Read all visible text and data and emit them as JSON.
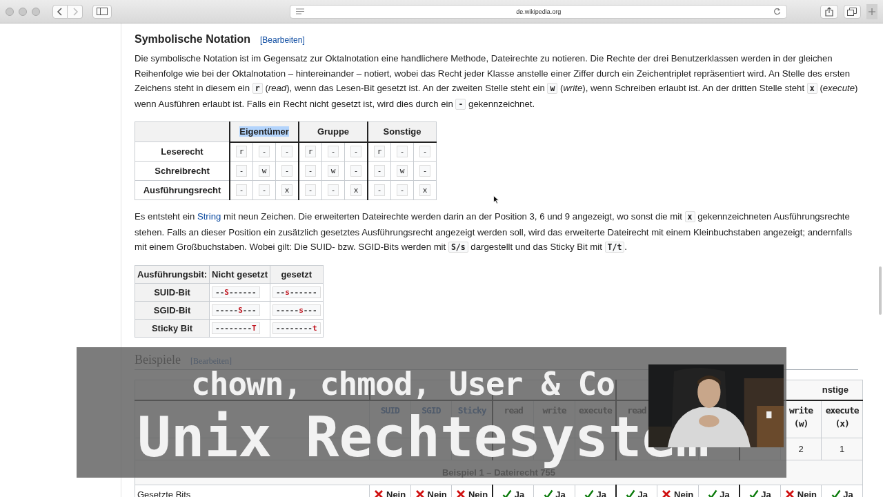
{
  "browser": {
    "url": "de.wikipedia.org"
  },
  "section": {
    "title": "Symbolische Notation",
    "edit": "[Bearbeiten]"
  },
  "paragraph_1": [
    {
      "text": "Die symbolische Notation ist im Gegensatz zur Oktalnotation eine handlichere Methode, Dateirechte zu notieren. Die Rechte der drei Benutzerklassen werden in der gleichen Reihenfolge wie bei der Oktalnotation – hintereinander – notiert, wobei das Recht jeder Klasse anstelle einer Ziffer durch ein Zeichentriplet repräsentiert wird. An Stelle des ersten Zeichens steht in diesem ein ",
      "kind": "plain"
    },
    {
      "text": "r",
      "kind": "code"
    },
    {
      "text": " (",
      "kind": "plain"
    },
    {
      "text": "read",
      "kind": "italic"
    },
    {
      "text": "), wenn das Lesen-Bit gesetzt ist. An der zweiten Stelle steht ein ",
      "kind": "plain"
    },
    {
      "text": "w",
      "kind": "code"
    },
    {
      "text": " (",
      "kind": "plain"
    },
    {
      "text": "write",
      "kind": "italic"
    },
    {
      "text": "), wenn Schreiben erlaubt ist. An der dritten Stelle steht ",
      "kind": "plain"
    },
    {
      "text": "x",
      "kind": "code"
    },
    {
      "text": " (",
      "kind": "plain"
    },
    {
      "text": "execute",
      "kind": "italic"
    },
    {
      "text": ") wenn Ausführen erlaubt ist. Falls ein Recht nicht gesetzt ist, wird dies durch ein ",
      "kind": "plain"
    },
    {
      "text": "-",
      "kind": "code"
    },
    {
      "text": " gekennzeichnet.",
      "kind": "plain"
    }
  ],
  "rights_table": {
    "groups": [
      {
        "label": "Eigentümer",
        "highlighted": true
      },
      {
        "label": "Gruppe",
        "highlighted": false
      },
      {
        "label": "Sonstige",
        "highlighted": false
      }
    ],
    "rows": [
      {
        "label": "Leserecht",
        "cells": [
          "r",
          "-",
          "-",
          "r",
          "-",
          "-",
          "r",
          "-",
          "-"
        ]
      },
      {
        "label": "Schreibrecht",
        "cells": [
          "-",
          "w",
          "-",
          "-",
          "w",
          "-",
          "-",
          "w",
          "-"
        ]
      },
      {
        "label": "Ausführungsrecht",
        "cells": [
          "-",
          "-",
          "x",
          "-",
          "-",
          "x",
          "-",
          "-",
          "x"
        ]
      }
    ]
  },
  "paragraph_2": [
    {
      "text": "Es entsteht ein ",
      "kind": "plain"
    },
    {
      "text": "String",
      "kind": "link"
    },
    {
      "text": " mit neun Zeichen. Die erweiterten Dateirechte werden darin an der Position 3, 6 und 9 angezeigt, wo sonst die mit ",
      "kind": "plain"
    },
    {
      "text": "x",
      "kind": "code"
    },
    {
      "text": " gekennzeichneten Ausführungsrechte stehen. Falls an dieser Position ein zusätzlich gesetztes Ausführungsrecht angezeigt werden soll, wird das erweiterte Dateirecht mit einem Kleinbuchstaben angezeigt; andernfalls mit einem Großbuchstaben. Wobei gilt: Die SUID- bzw. SGID-Bits werden mit ",
      "kind": "plain"
    },
    {
      "text": "S/s",
      "kind": "code"
    },
    {
      "text": " dargestellt und das Sticky Bit mit ",
      "kind": "plain"
    },
    {
      "text": "T/t",
      "kind": "code"
    },
    {
      "text": ".",
      "kind": "plain"
    }
  ],
  "bits_table": {
    "corner": "Ausführungsbit:",
    "columns": [
      "Nicht gesetzt",
      "gesetzt"
    ],
    "rows": [
      {
        "label": "SUID-Bit",
        "cells": [
          {
            "prefix": "--",
            "bit": "S",
            "suffix": "------"
          },
          {
            "prefix": "--",
            "bit": "s",
            "suffix": "------"
          }
        ]
      },
      {
        "label": "SGID-Bit",
        "cells": [
          {
            "prefix": "-----",
            "bit": "S",
            "suffix": "---"
          },
          {
            "prefix": "-----",
            "bit": "s",
            "suffix": "---"
          }
        ]
      },
      {
        "label": "Sticky Bit",
        "cells": [
          {
            "prefix": "--------",
            "bit": "T"
          },
          {
            "prefix": "--------",
            "bit": "t"
          }
        ]
      }
    ]
  },
  "examples": {
    "title": "Beispiele",
    "edit": "[Bearbeiten]",
    "last_group": "nstige",
    "columns": [
      {
        "name": "SUID",
        "link": true
      },
      {
        "name": "SGID",
        "link": true
      },
      {
        "name": "Sticky",
        "link": true
      },
      {
        "name": "read",
        "link": false
      },
      {
        "name": "write",
        "link": false
      },
      {
        "name": "execute",
        "link": false
      },
      {
        "name": "read",
        "link": false
      },
      {},
      {},
      {},
      {
        "name": "write",
        "note": "(w)",
        "link": false
      },
      {
        "name": "execute",
        "note": "(x)",
        "link": false
      }
    ],
    "value_row": {
      "cells": [
        {},
        {},
        {},
        {},
        {},
        {},
        {},
        {},
        {},
        {},
        {
          "text": "2"
        },
        {
          "text": "1"
        }
      ]
    },
    "example_title": "Beispiel 1 – Dateirecht 755",
    "bits_row": {
      "label": "Gesetzte Bits",
      "cells": [
        {
          "label": "Nein",
          "set": false
        },
        {
          "label": "Nein",
          "set": false
        },
        {
          "label": "Nein",
          "set": false
        },
        {
          "label": "Ja",
          "set": true
        },
        {
          "label": "Ja",
          "set": true
        },
        {
          "label": "Ja",
          "set": true
        },
        {
          "label": "Ja",
          "set": true
        },
        {
          "label": "Nein",
          "set": false
        },
        {
          "label": "Ja",
          "set": true
        },
        {
          "label": "Ja",
          "set": true
        },
        {
          "label": "Nein",
          "set": false
        },
        {
          "label": "Ja",
          "set": true
        }
      ]
    }
  },
  "banner": {
    "subtitle": "chown, chmod, User & Co",
    "title": "Unix Rechtesystem"
  }
}
